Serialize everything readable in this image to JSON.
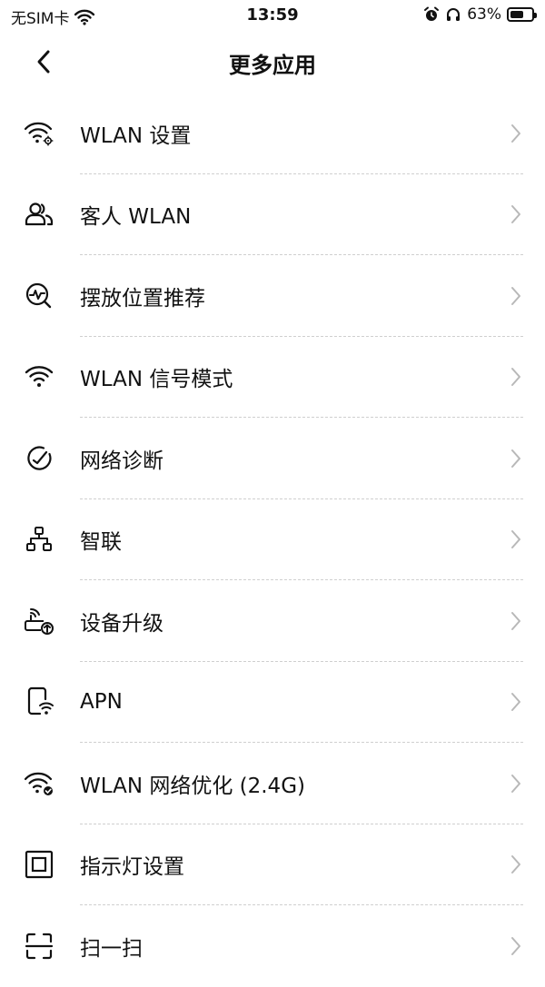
{
  "status_bar": {
    "carrier": "无SIM卡",
    "time": "13:59",
    "battery_percent": "63%",
    "battery_level": 0.63
  },
  "nav": {
    "title": "更多应用"
  },
  "items": [
    {
      "label": "WLAN 设置",
      "icon": "wifi-settings-icon"
    },
    {
      "label": "客人 WLAN",
      "icon": "guest-users-icon"
    },
    {
      "label": "摆放位置推荐",
      "icon": "placement-search-icon"
    },
    {
      "label": "WLAN 信号模式",
      "icon": "wifi-icon"
    },
    {
      "label": "网络诊断",
      "icon": "diagnosis-gauge-icon"
    },
    {
      "label": "智联",
      "icon": "network-topology-icon"
    },
    {
      "label": "设备升级",
      "icon": "router-upgrade-icon"
    },
    {
      "label": "APN",
      "icon": "phone-wifi-icon"
    },
    {
      "label": "WLAN 网络优化 (2.4G)",
      "icon": "wifi-check-icon"
    },
    {
      "label": "指示灯设置",
      "icon": "indicator-light-icon"
    },
    {
      "label": "扫一扫",
      "icon": "scan-icon"
    }
  ],
  "colors": {
    "text": "#111111",
    "chevron": "#b8b8b8",
    "divider": "#cfcfcf",
    "background": "#ffffff"
  }
}
